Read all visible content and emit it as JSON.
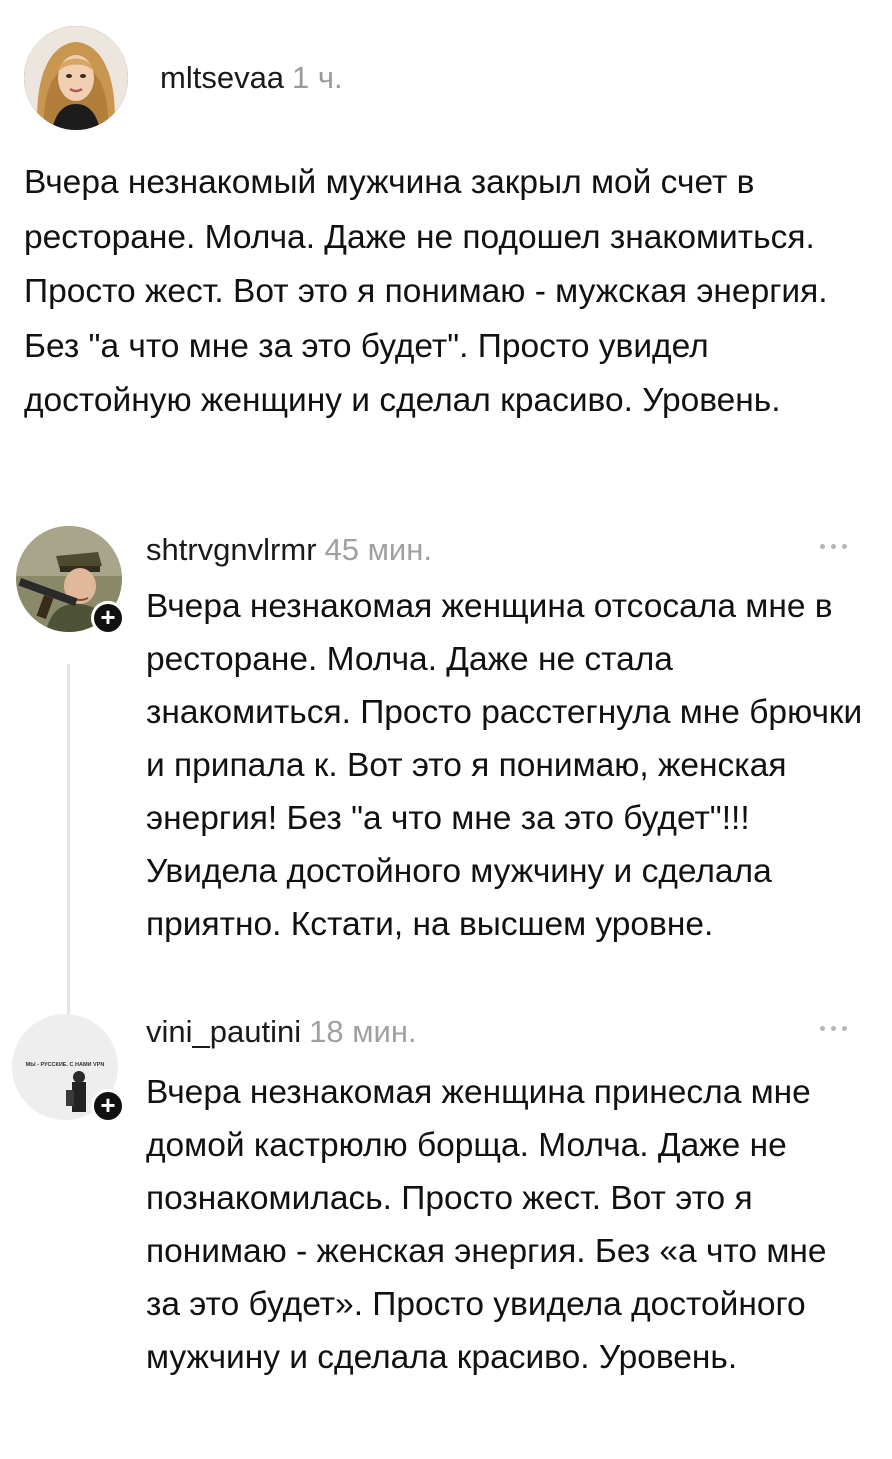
{
  "post": {
    "author": "mltsevaa",
    "time": "1 ч.",
    "text": "Вчера незнакомый мужчина закрыл мой счет в ресторане. Молча. Даже не подошел знакомиться. Просто жест. Вот это я понимаю - мужская энергия. Без \"а что мне за это будет\". Просто увидел достойную женщину и сделал красиво. Уровень."
  },
  "comments": [
    {
      "author": "shtrvgnvlrmr",
      "time": "45 мин.",
      "text": "Вчера незнакомая женщина отсосала мне в ресторане. Молча. Даже не стала знакомиться. Просто расстегнула мне брючки и припала к. Вот это я понимаю, женская энергия! Без \"а что мне за это будет\"!!! Увидела достойного мужчину и сделала приятно. Кстати, на высшем уровне.",
      "avatar_icon": "soldier-portrait-icon"
    },
    {
      "author": "vini_pautini",
      "time": "18 мин.",
      "text": "Вчера незнакомая женщина принесла мне домой кастрюлю борща. Молча. Даже не познакомилась. Просто жест. Вот это я понимаю - женская энергия. Без «а что мне за это будет». Просто увидела достойного мужчину и сделала красиво. Уровень.",
      "avatar_icon": "poster-figure-icon",
      "avatar_caption": "МЫ - РУССКИЕ. С НАМИ VPN"
    }
  ],
  "icons": {
    "follow": "+",
    "more": "more-dots-icon"
  }
}
